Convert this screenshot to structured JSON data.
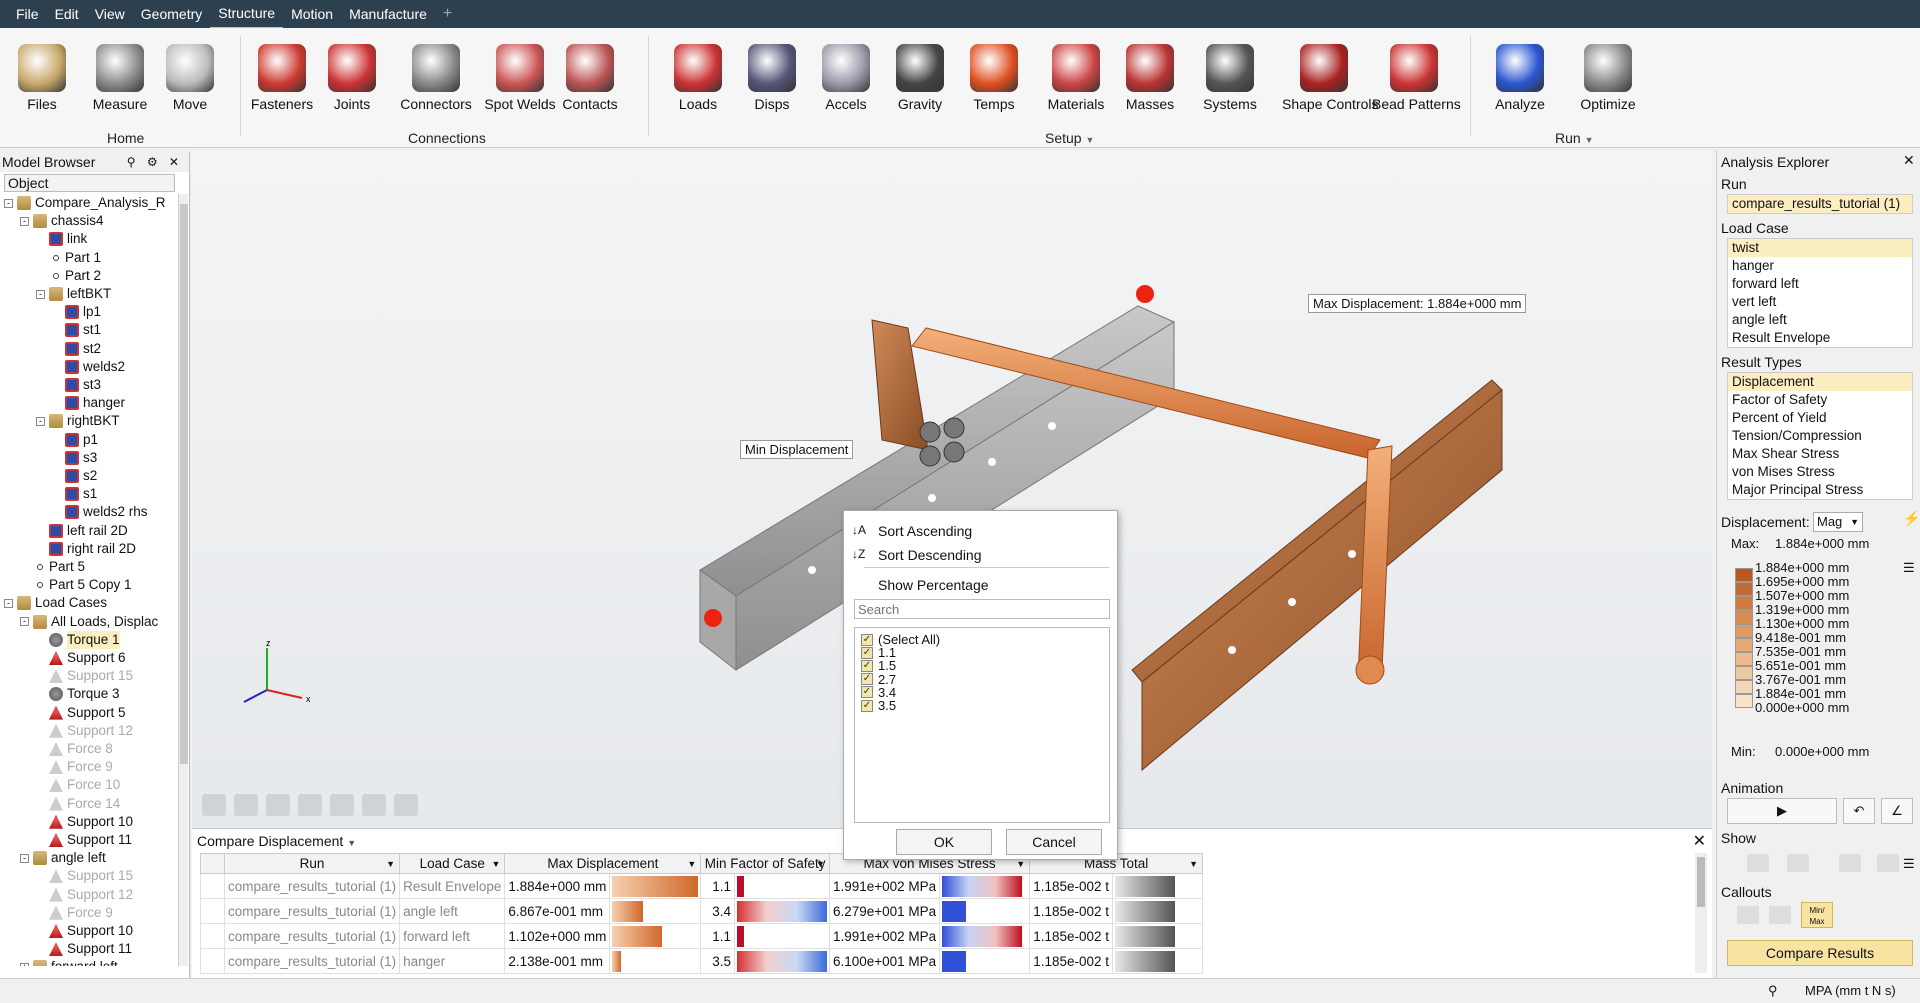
{
  "menubar": {
    "items": [
      "File",
      "Edit",
      "View",
      "Geometry",
      "Structure",
      "Motion",
      "Manufacture"
    ],
    "active": "Structure",
    "add_symbol": "+"
  },
  "ribbon": {
    "buttons": [
      {
        "label": "Files",
        "icon": "files-icon"
      },
      {
        "label": "Measure",
        "icon": "measure-icon"
      },
      {
        "label": "Move",
        "icon": "move-icon"
      },
      {
        "label": "Fasteners",
        "icon": "fasteners-icon"
      },
      {
        "label": "Joints",
        "icon": "joints-icon"
      },
      {
        "label": "Connectors",
        "icon": "connectors-icon"
      },
      {
        "label": "Spot Welds",
        "icon": "spot-welds-icon"
      },
      {
        "label": "Contacts",
        "icon": "contacts-icon"
      },
      {
        "label": "Loads",
        "icon": "loads-icon"
      },
      {
        "label": "Disps",
        "icon": "disps-icon"
      },
      {
        "label": "Accels",
        "icon": "accels-icon"
      },
      {
        "label": "Gravity",
        "icon": "gravity-icon"
      },
      {
        "label": "Temps",
        "icon": "temps-icon"
      },
      {
        "label": "Materials",
        "icon": "materials-icon"
      },
      {
        "label": "Masses",
        "icon": "masses-icon"
      },
      {
        "label": "Systems",
        "icon": "systems-icon"
      },
      {
        "label": "Shape Controls",
        "icon": "shape-controls-icon"
      },
      {
        "label": "Bead Patterns",
        "icon": "bead-patterns-icon"
      },
      {
        "label": "Analyze",
        "icon": "analyze-icon"
      },
      {
        "label": "Optimize",
        "icon": "optimize-icon"
      }
    ],
    "groups": {
      "home": "Home",
      "connections": "Connections",
      "setup": "Setup",
      "run": "Run"
    },
    "dropdown_symbol": "▼"
  },
  "model_browser": {
    "title": "Model Browser",
    "tools": "⚲ ⚙ ✕",
    "column": "Object",
    "tree": [
      {
        "label": "Compare_Analysis_R",
        "icon": "folder",
        "level": 0,
        "toggle": "-"
      },
      {
        "label": "chassis4",
        "icon": "folder",
        "level": 1,
        "toggle": "-"
      },
      {
        "label": "link",
        "icon": "comp",
        "level": 2
      },
      {
        "label": "Part 1",
        "icon": "dot",
        "level": 2
      },
      {
        "label": "Part 2",
        "icon": "dot",
        "level": 2
      },
      {
        "label": "leftBKT",
        "icon": "folder",
        "level": 2,
        "toggle": "-"
      },
      {
        "label": "lp1",
        "icon": "comp",
        "level": 3
      },
      {
        "label": "st1",
        "icon": "comp",
        "level": 3
      },
      {
        "label": "st2",
        "icon": "comp",
        "level": 3
      },
      {
        "label": "welds2",
        "icon": "comp",
        "level": 3
      },
      {
        "label": "st3",
        "icon": "comp",
        "level": 3
      },
      {
        "label": "hanger",
        "icon": "comp",
        "level": 3
      },
      {
        "label": "rightBKT",
        "icon": "folder",
        "level": 2,
        "toggle": "-"
      },
      {
        "label": "p1",
        "icon": "comp",
        "level": 3
      },
      {
        "label": "s3",
        "icon": "comp",
        "level": 3
      },
      {
        "label": "s2",
        "icon": "comp",
        "level": 3
      },
      {
        "label": "s1",
        "icon": "comp",
        "level": 3
      },
      {
        "label": "welds2 rhs",
        "icon": "comp",
        "level": 3
      },
      {
        "label": "left rail 2D",
        "icon": "comp",
        "level": 2
      },
      {
        "label": "right rail 2D",
        "icon": "comp",
        "level": 2
      },
      {
        "label": "Part 5",
        "icon": "dot",
        "level": 1
      },
      {
        "label": "Part 5 Copy 1",
        "icon": "dot",
        "level": 1
      },
      {
        "label": "Load Cases",
        "icon": "folder",
        "level": 0,
        "toggle": "-"
      },
      {
        "label": "All Loads, Displac",
        "icon": "folder",
        "level": 1,
        "toggle": "-"
      },
      {
        "label": "Torque 1",
        "icon": "torque",
        "level": 2,
        "selected": true
      },
      {
        "label": "Support 6",
        "icon": "load",
        "level": 2
      },
      {
        "label": "Support 15",
        "icon": "load",
        "level": 2,
        "dim": true
      },
      {
        "label": "Torque 3",
        "icon": "torque",
        "level": 2
      },
      {
        "label": "Support 5",
        "icon": "load",
        "level": 2
      },
      {
        "label": "Support 12",
        "icon": "load",
        "level": 2,
        "dim": true
      },
      {
        "label": "Force 8",
        "icon": "load",
        "level": 2,
        "dim": true
      },
      {
        "label": "Force 9",
        "icon": "load",
        "level": 2,
        "dim": true
      },
      {
        "label": "Force 10",
        "icon": "load",
        "level": 2,
        "dim": true
      },
      {
        "label": "Force 14",
        "icon": "load",
        "level": 2,
        "dim": true
      },
      {
        "label": "Support 10",
        "icon": "load",
        "level": 2
      },
      {
        "label": "Support 11",
        "icon": "load",
        "level": 2
      },
      {
        "label": "angle left",
        "icon": "folder",
        "level": 1,
        "toggle": "-"
      },
      {
        "label": "Support 15",
        "icon": "load",
        "level": 2,
        "dim": true
      },
      {
        "label": "Support 12",
        "icon": "load",
        "level": 2,
        "dim": true
      },
      {
        "label": "Force 9",
        "icon": "load",
        "level": 2,
        "dim": true
      },
      {
        "label": "Support 10",
        "icon": "load",
        "level": 2
      },
      {
        "label": "Support 11",
        "icon": "load",
        "level": 2
      },
      {
        "label": "forward left",
        "icon": "folder",
        "level": 1,
        "toggle": "+"
      }
    ]
  },
  "viewport": {
    "max_callout": "Max Displacement: 1.884e+000 mm",
    "min_callout": "Min Displacement",
    "axis_labels": {
      "x": "x",
      "y": "y",
      "z": "z"
    }
  },
  "compare": {
    "title": "Compare Displacement",
    "close": "✕",
    "columns": [
      "Run",
      "Load Case",
      "Max Displacement",
      "Min Factor of Safety",
      "Max von Mises Stress",
      "Mass Total"
    ],
    "rows": [
      {
        "run": "compare_results_tutorial (1)",
        "load_case": "Result Envelope",
        "max_disp": "1.884e+000 mm",
        "disp_frac": 1.0,
        "fos": "1.1",
        "vm": "1.991e+002 MPa",
        "mass": "1.185e-002 t"
      },
      {
        "run": "compare_results_tutorial (1)",
        "load_case": "angle left",
        "max_disp": "6.867e-001 mm",
        "disp_frac": 0.36,
        "fos": "3.4",
        "vm": "6.279e+001 MPa",
        "mass": "1.185e-002 t"
      },
      {
        "run": "compare_results_tutorial (1)",
        "load_case": "forward left",
        "max_disp": "1.102e+000 mm",
        "disp_frac": 0.58,
        "fos": "1.1",
        "vm": "1.991e+002 MPa",
        "mass": "1.185e-002 t"
      },
      {
        "run": "compare_results_tutorial (1)",
        "load_case": "hanger",
        "max_disp": "2.138e-001 mm",
        "disp_frac": 0.11,
        "fos": "3.5",
        "vm": "6.100e+001 MPa",
        "mass": "1.185e-002 t"
      }
    ]
  },
  "filter_popup": {
    "sort_asc": "Sort Ascending",
    "sort_desc": "Sort Descending",
    "show_pct": "Show Percentage",
    "search_placeholder": "Search",
    "options": [
      "(Select All)",
      "1.1",
      "1.5",
      "2.7",
      "3.4",
      "3.5"
    ],
    "ok": "OK",
    "cancel": "Cancel"
  },
  "analysis_explorer": {
    "title": "Analysis Explorer",
    "close": "✕",
    "run_label": "Run",
    "run_value": "compare_results_tutorial (1)",
    "load_case_label": "Load Case",
    "load_cases": [
      "twist",
      "hanger",
      "forward left",
      "vert left",
      "angle left",
      "Result Envelope"
    ],
    "result_types_label": "Result Types",
    "result_types": [
      "Displacement",
      "Factor of Safety",
      "Percent of Yield",
      "Tension/Compression",
      "Max Shear Stress",
      "von Mises Stress",
      "Major Principal Stress"
    ],
    "legend_label": "Displacement:",
    "legend_mode": "Mag",
    "max_label": "Max:",
    "max_value": "1.884e+000 mm",
    "min_label": "Min:",
    "min_value": "0.000e+000 mm",
    "legend_values": [
      "1.884e+000 mm",
      "1.695e+000 mm",
      "1.507e+000 mm",
      "1.319e+000 mm",
      "1.130e+000 mm",
      "9.418e-001 mm",
      "7.535e-001 mm",
      "5.651e-001 mm",
      "3.767e-001 mm",
      "1.884e-001 mm",
      "0.000e+000 mm"
    ],
    "animation_label": "Animation",
    "show_label": "Show",
    "callouts_label": "Callouts",
    "minmax_label": "Min/ Max",
    "compare_button": "Compare Results"
  },
  "status": {
    "units": "MPA (mm t N s)"
  }
}
